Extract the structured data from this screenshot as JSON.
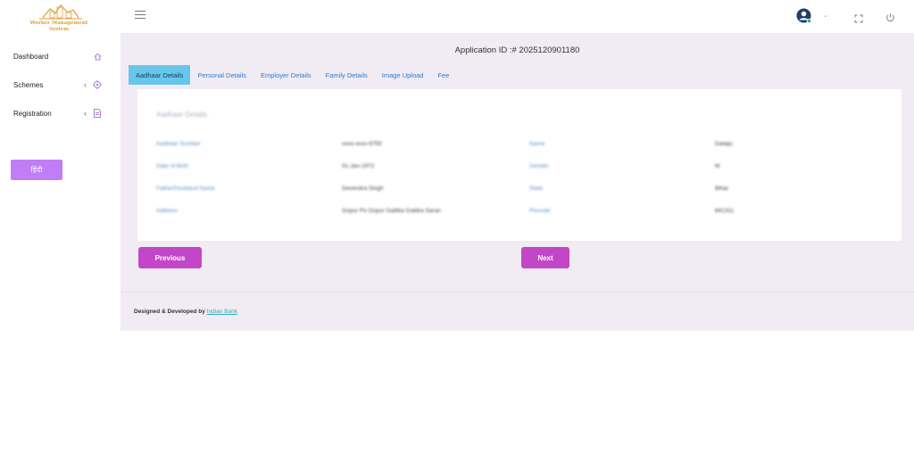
{
  "logo": {
    "line1": "Worker Management",
    "line2": "System"
  },
  "sidebar": {
    "items": [
      {
        "label": "Dashboard",
        "icon": "home-icon"
      },
      {
        "label": "Schemes",
        "icon": "target-icon"
      },
      {
        "label": "Registration",
        "icon": "document-icon"
      }
    ],
    "language_button": "हिंदी"
  },
  "topbar": {
    "menu_icon": "hamburger-icon",
    "user_icon": "user-avatar-icon",
    "fullscreen_icon": "fullscreen-icon",
    "power_icon": "power-icon"
  },
  "main": {
    "application_id": "Application ID :# 2025120901180",
    "tabs": [
      "Aadhaar Details",
      "Personal Details",
      "Employer Details",
      "Family Details",
      "Image Upload",
      "Fee"
    ],
    "active_tab": "Aadhaar Details",
    "card": {
      "title": "Aadhaar Details",
      "fields": [
        {
          "label": "Aadhaar Number",
          "value": "xxxx-xxxx-6750"
        },
        {
          "label": "Name",
          "value": "Dalaiju"
        },
        {
          "label": "Date of Birth",
          "value": "01-Jan-1972"
        },
        {
          "label": "Gender",
          "value": "M"
        },
        {
          "label": "Father/Husband Name",
          "value": "Devendra Singh"
        },
        {
          "label": "State",
          "value": "Bihar"
        },
        {
          "label": "Address",
          "value": "Gopur Po Gopur Gaitika Gaitika Saran"
        },
        {
          "label": "Pincode",
          "value": "841311"
        }
      ]
    },
    "previous_label": "Previous",
    "next_label": "Next"
  },
  "footer": {
    "text": "Designed & Developed by",
    "link": "Indian Bank"
  },
  "colors": {
    "accent": "#c246c6",
    "language_button": "#c17df6",
    "active_tab": "#68c6ec",
    "link": "#2a7bd4",
    "background": "#f1ecf3"
  }
}
